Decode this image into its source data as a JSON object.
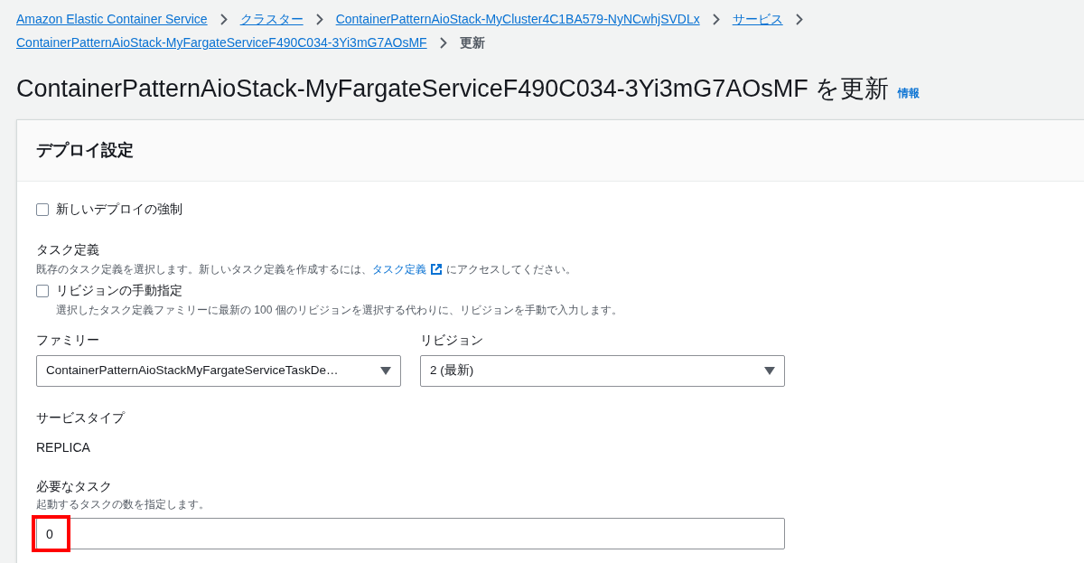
{
  "breadcrumbs": [
    {
      "label": "Amazon Elastic Container Service",
      "link": true
    },
    {
      "label": "クラスター",
      "link": true
    },
    {
      "label": "ContainerPatternAioStack-MyCluster4C1BA579-NyNCwhjSVDLx",
      "link": true
    },
    {
      "label": "サービス",
      "link": true
    },
    {
      "label": "ContainerPatternAioStack-MyFargateServiceF490C034-3Yi3mG7AOsMF",
      "link": true
    },
    {
      "label": "更新",
      "link": false
    }
  ],
  "page_title": "ContainerPatternAioStack-MyFargateServiceF490C034-3Yi3mG7AOsMF を更新",
  "info_link": "情報",
  "panel": {
    "title": "デプロイ設定",
    "force_deploy": {
      "label": "新しいデプロイの強制",
      "checked": false
    },
    "task_definition": {
      "label": "タスク定義",
      "description_before": "既存のタスク定義を選択します。新しいタスク定義を作成するには、",
      "description_link": "タスク定義",
      "description_after": "にアクセスしてください。",
      "manual_revision": {
        "label": "リビジョンの手動指定",
        "checked": false,
        "description": "選択したタスク定義ファミリーに最新の 100 個のリビジョンを選択する代わりに、リビジョンを手動で入力します。"
      },
      "family": {
        "label": "ファミリー",
        "value": "ContainerPatternAioStackMyFargateServiceTaskDe…"
      },
      "revision": {
        "label": "リビジョン",
        "value": "2 (最新)"
      }
    },
    "service_type": {
      "label": "サービスタイプ",
      "value": "REPLICA"
    },
    "desired_tasks": {
      "label": "必要なタスク",
      "description": "起動するタスクの数を指定します。",
      "value": "0",
      "highlighted": true
    }
  }
}
